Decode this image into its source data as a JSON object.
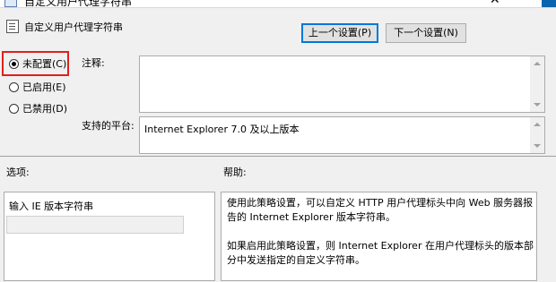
{
  "window": {
    "title": "自定义用户代理字符串"
  },
  "header": {
    "policy_title": "自定义用户代理字符串",
    "prev_button": "上一个设置(P)",
    "next_button": "下一个设置(N)"
  },
  "state_options": [
    {
      "label": "未配置(C)",
      "checked": true
    },
    {
      "label": "已启用(E)",
      "checked": false
    },
    {
      "label": "已禁用(D)",
      "checked": false
    }
  ],
  "comment": {
    "label": "注释:",
    "value": ""
  },
  "supported": {
    "label": "支持的平台:",
    "value": "Internet Explorer 7.0 及以上版本"
  },
  "options": {
    "label": "选项:",
    "field_label": "输入 IE 版本字符串",
    "field_value": ""
  },
  "help": {
    "label": "帮助:",
    "paragraphs": [
      "使用此策略设置，可以自定义 HTTP 用户代理标头中向 Web 服务器报告的 Internet Explorer 版本字符串。",
      "如果启用此策略设置，则 Internet Explorer 在用户代理标头的版本部分中发送指定的自定义字符串。"
    ]
  },
  "colors": {
    "highlight": "#e0201c",
    "accent": "#0078d7"
  }
}
